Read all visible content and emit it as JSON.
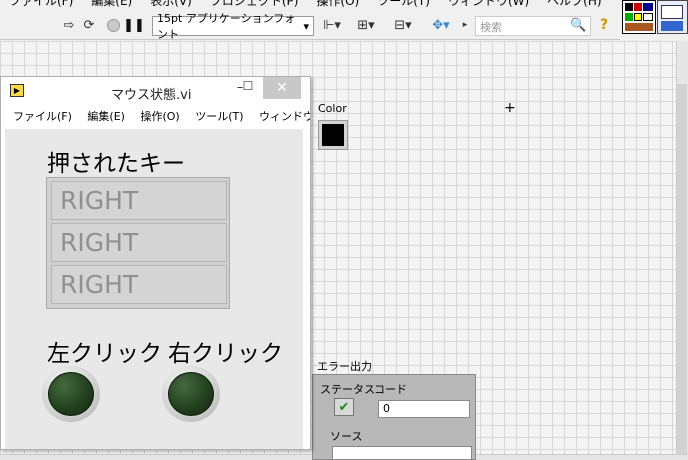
{
  "menubar": {
    "items": [
      "ファイル(F)",
      "編集(E)",
      "表示(V)",
      "プロジェクト(P)",
      "操作(O)",
      "ツール(T)",
      "ウィンドウ(W)",
      "ヘルプ(H)"
    ]
  },
  "toolbar": {
    "icons": [
      "run-arrow-icon",
      "run-continuous-icon",
      "abort-icon",
      "pause-icon",
      "align-icon",
      "distribute-icon",
      "resize-icon",
      "reorder-icon"
    ],
    "font_select": "15pt アプリケーションフォント",
    "search_placeholder": "検索",
    "help_glyph": "?"
  },
  "front_panel": {
    "color": {
      "label": "Color",
      "value": "#000000"
    },
    "error_out": {
      "label": "エラー出力",
      "status_label": "ステータス",
      "code_label": "コード",
      "code_value": "0",
      "source_label": "ソース",
      "status_ok": true
    }
  },
  "vi_window": {
    "title": "マウス状態.vi",
    "menu": [
      "ファイル(F)",
      "編集(E)",
      "操作(O)",
      "ツール(T)",
      "ウィンドウ("
    ],
    "keys_label": "押されたキー",
    "keys": [
      "RIGHT",
      "RIGHT",
      "RIGHT"
    ],
    "left_click_label": "左クリック",
    "right_click_label": "右クリック",
    "left_click_on": false,
    "right_click_on": false
  }
}
